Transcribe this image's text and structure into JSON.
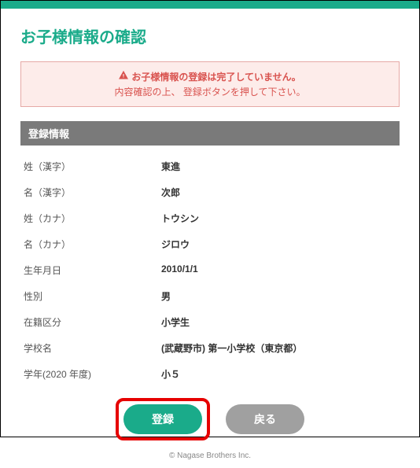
{
  "page_title": "お子様情報の確認",
  "alert": {
    "line1": "お子様情報の登録は完了していません。",
    "line2": "内容確認の上、 登録ボタンを押して下さい。"
  },
  "section_header": "登録情報",
  "fields": {
    "last_name_kanji_label": "姓（漢字）",
    "last_name_kanji_value": "東進",
    "first_name_kanji_label": "名（漢字）",
    "first_name_kanji_value": "次郎",
    "last_name_kana_label": "姓（カナ）",
    "last_name_kana_value": "トウシン",
    "first_name_kana_label": "名（カナ）",
    "first_name_kana_value": "ジロウ",
    "birthdate_label": "生年月日",
    "birthdate_value": "2010/1/1",
    "gender_label": "性別",
    "gender_value": "男",
    "enrollment_label": "在籍区分",
    "enrollment_value": "小学生",
    "school_label": "学校名",
    "school_value": "(武蔵野市) 第一小学校（東京都）",
    "grade_label": "学年(2020 年度)",
    "grade_value": "小５"
  },
  "buttons": {
    "register": "登録",
    "back": "戻る"
  },
  "footer": "© Nagase Brothers Inc."
}
